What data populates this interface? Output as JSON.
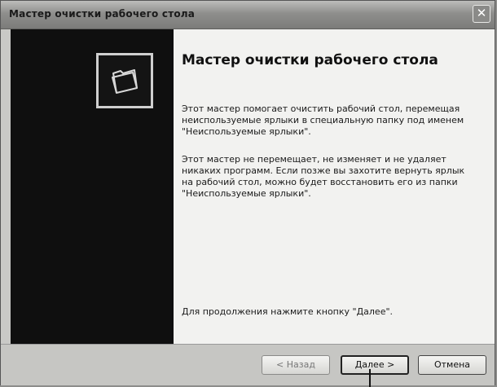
{
  "window": {
    "title": "Мастер очистки рабочего стола",
    "close_symbol": "✕"
  },
  "sidebar": {
    "icon": "folder-icon"
  },
  "main": {
    "heading": "Мастер очистки рабочего стола",
    "paragraph1": "Этот мастер помогает очистить рабочий стол, перемещая неиспользуемые ярлыки в специальную папку под именем \"Неиспользуемые ярлыки\".",
    "paragraph2": "Этот мастер не перемещает, не изменяет и не удаляет никаких программ. Если позже вы захотите вернуть ярлык на рабочий стол, можно будет восстановить его из папки \"Неиспользуемые ярлыки\".",
    "paragraph3": "Для продолжения нажмите кнопку \"Далее\"."
  },
  "buttons": {
    "back": "< Назад",
    "next": "Далее >",
    "cancel": "Отмена"
  }
}
